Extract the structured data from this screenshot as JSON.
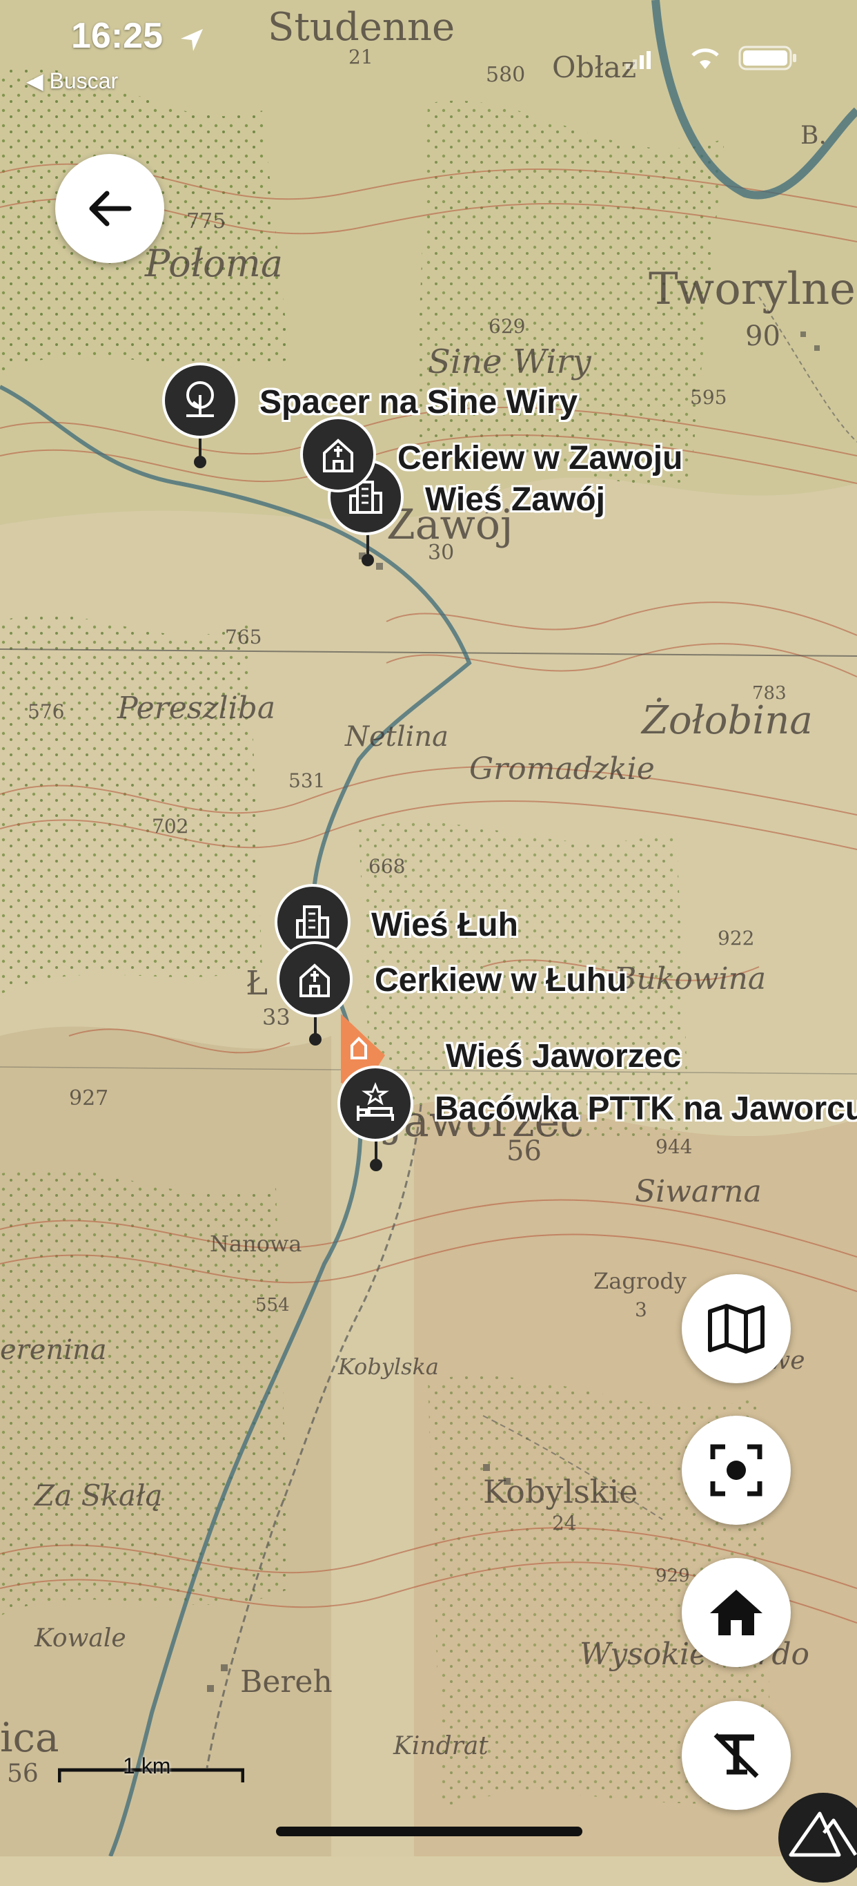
{
  "status_bar": {
    "time": "16:25",
    "back_app": "Buscar"
  },
  "map_labels": [
    "Studenne",
    "21",
    "580",
    "Obłaz",
    "B.",
    "775",
    "Połoma",
    "Tworylne",
    "90",
    "629",
    "595",
    "Sine Wiry",
    "Zawój",
    "30",
    "765",
    "Pereszliba",
    "576",
    "Netlina",
    "531",
    "Gromadzkie",
    "Żołobina",
    "783",
    "668",
    "702",
    "922",
    "Bukowina",
    "33",
    "Ł",
    "927",
    "Jaworzec",
    "56",
    "944",
    "Siwarna",
    "Nanowa",
    "554",
    "Zagrody",
    "3",
    "Kobylska",
    "erenina",
    "Kobylskie",
    "24",
    "Za Skałą",
    "Kowale",
    "Bereh",
    "929",
    "Wysokie Berdo",
    "Kindrat",
    "ica",
    "56",
    "Krywe"
  ],
  "pins": [
    {
      "name": "walk",
      "label": "Spacer na Sine Wiry",
      "icon": "tree-icon"
    },
    {
      "name": "church-zawoj",
      "label": "Cerkiew w Zawoju",
      "icon": "church-icon"
    },
    {
      "name": "village-zawoj",
      "label": "Wieś Zawój",
      "icon": "buildings-icon"
    },
    {
      "name": "village-luh",
      "label": "Wieś Łuh",
      "icon": "buildings-icon"
    },
    {
      "name": "church-luh",
      "label": "Cerkiew w Łuhu",
      "icon": "church-icon"
    },
    {
      "name": "village-jaworzec",
      "label": "Wieś Jaworzec",
      "icon": "church-icon"
    },
    {
      "name": "bacowka",
      "label": "Bacówka PTTK na Jaworcu",
      "icon": "bed-icon"
    }
  ],
  "scale_bar": {
    "label": "1 km"
  },
  "controls": {
    "map_layers": "map-icon",
    "locate": "locate-icon",
    "home": "home-icon",
    "text_off": "text-off-icon"
  },
  "colors": {
    "map_base": "#d8cda6",
    "contour": "#b5553a",
    "forest": "#8fa24a",
    "river": "#3c6a78",
    "pin": "#2b2b2b",
    "highlight": "#f08a55"
  }
}
